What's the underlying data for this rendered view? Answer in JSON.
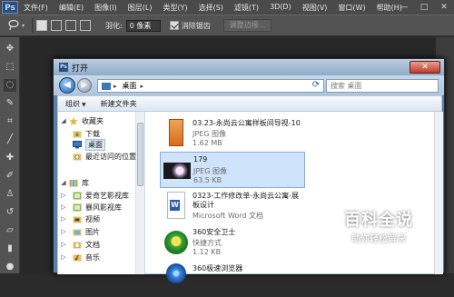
{
  "app": {
    "logo": "Ps"
  },
  "menubar": {
    "items": [
      "文件(F)",
      "编辑(E)",
      "图像(I)",
      "图层(L)",
      "类型(Y)",
      "选择(S)",
      "滤镜(T)",
      "3D(D)",
      "视图(V)",
      "窗口(W)",
      "帮助(H)"
    ],
    "min": "—",
    "max": "□",
    "close": "✕"
  },
  "optionsbar": {
    "feather_label": "羽化:",
    "feather_value": "0 像素",
    "antialias_label": "消除锯齿",
    "refine_edge_label": "调整边缘..."
  },
  "dialog": {
    "title": "打开",
    "address": "桌面",
    "search_placeholder": "搜索 桌面",
    "toolbar": {
      "organize": "组织",
      "new_folder": "新建文件夹"
    },
    "nav": [
      {
        "label": "收藏夹",
        "icon": "star-icon",
        "level": 0,
        "expand": "◢"
      },
      {
        "label": "下载",
        "icon": "download-folder-icon",
        "level": 1
      },
      {
        "label": "桌面",
        "icon": "desktop-icon",
        "level": 1,
        "selected": true
      },
      {
        "label": "最近访问的位置",
        "icon": "recent-places-icon",
        "level": 1
      },
      {
        "label": "库",
        "icon": "library-icon",
        "level": 0,
        "expand": "◢"
      },
      {
        "label": "爱奇艺影视库",
        "icon": "video-library-icon",
        "level": 1,
        "expand": "▷"
      },
      {
        "label": "暴风影视库",
        "icon": "video-library-icon",
        "level": 1,
        "expand": "▷"
      },
      {
        "label": "视频",
        "icon": "video-folder-icon",
        "level": 1,
        "expand": "▷"
      },
      {
        "label": "图片",
        "icon": "pictures-folder-icon",
        "level": 1,
        "expand": "▷"
      },
      {
        "label": "文档",
        "icon": "documents-folder-icon",
        "level": 1,
        "expand": "▷"
      },
      {
        "label": "音乐",
        "icon": "music-folder-icon",
        "level": 1,
        "expand": "▷"
      }
    ],
    "files": [
      {
        "name": "03.23-永尚云公寓样板间导视-10",
        "type": "JPEG 图像",
        "size": "1.62 MB",
        "thumb": "orange-poster-thumb"
      },
      {
        "name": "179",
        "type": "JPEG 图像",
        "size": "63.5 KB",
        "thumb": "flower-photo-thumb",
        "selected": true
      },
      {
        "name": "0323-工作修改单-永尚云公寓-展",
        "name2": "板设计",
        "type": "Microsoft Word 文档",
        "thumb": "word-doc-icon"
      },
      {
        "name": "360安全卫士",
        "type": "快捷方式",
        "size": "1.12 KB",
        "thumb": "360-security-icon"
      },
      {
        "name": "360极速浏览器",
        "type": "",
        "thumb": "360-browser-icon"
      }
    ]
  },
  "watermark": {
    "title": "百科全说",
    "subtitle": "助你轻松解决"
  }
}
